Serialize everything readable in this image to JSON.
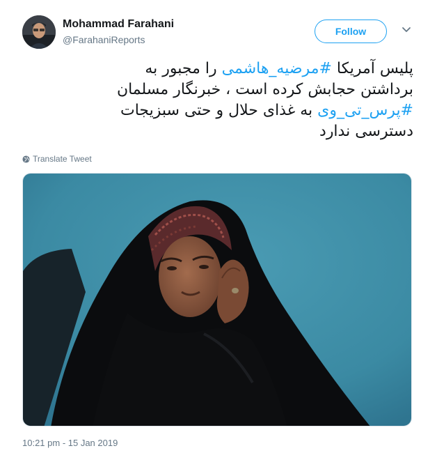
{
  "author": {
    "name": "Mohammad Farahani",
    "handle": "@FarahaniReports",
    "avatar_icon": "profile-photo"
  },
  "follow_label": "Follow",
  "caret_icon": "chevron-down-icon",
  "tweet": {
    "line1_prefix": "پلیس آمریکا ",
    "line1_hashtag": "#مرضیه_هاشمی",
    "line1_suffix": " را مجبور به",
    "line2": "برداشتن حجابش کرده است ، خبرنگار مسلمان",
    "line3_hashtag": "#پرس_تی_وی",
    "line3_suffix": " به غذای  حلال و حتی سبزیجات",
    "line4": "دسترسی ندارد"
  },
  "translate_label": "Translate Tweet",
  "translate_icon": "globe-icon",
  "media": {
    "description_icon": "photo"
  },
  "timestamp": "10:21 pm - 15 Jan 2019",
  "colors": {
    "accent": "#1da1f2",
    "secondary_text": "#657786",
    "photo_background": "#3f8fa6"
  }
}
